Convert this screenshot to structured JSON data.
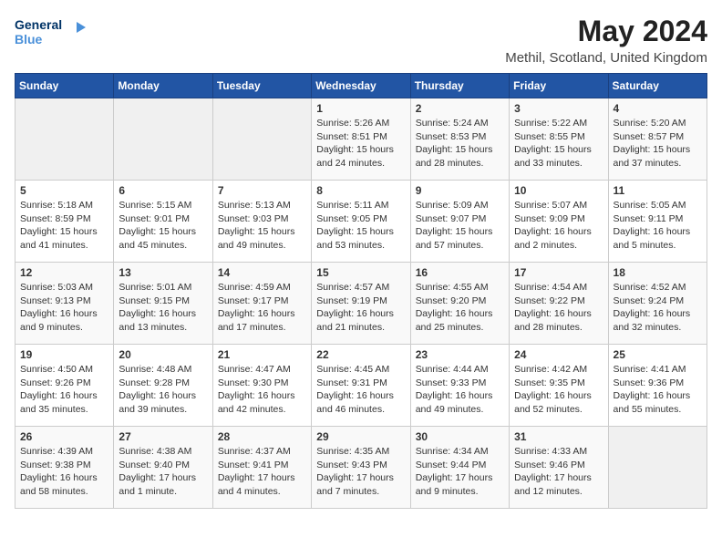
{
  "header": {
    "logo_line1": "General",
    "logo_line2": "Blue",
    "month_year": "May 2024",
    "location": "Methil, Scotland, United Kingdom"
  },
  "days_of_week": [
    "Sunday",
    "Monday",
    "Tuesday",
    "Wednesday",
    "Thursday",
    "Friday",
    "Saturday"
  ],
  "weeks": [
    [
      {
        "day": "",
        "info": ""
      },
      {
        "day": "",
        "info": ""
      },
      {
        "day": "",
        "info": ""
      },
      {
        "day": "1",
        "info": "Sunrise: 5:26 AM\nSunset: 8:51 PM\nDaylight: 15 hours\nand 24 minutes."
      },
      {
        "day": "2",
        "info": "Sunrise: 5:24 AM\nSunset: 8:53 PM\nDaylight: 15 hours\nand 28 minutes."
      },
      {
        "day": "3",
        "info": "Sunrise: 5:22 AM\nSunset: 8:55 PM\nDaylight: 15 hours\nand 33 minutes."
      },
      {
        "day": "4",
        "info": "Sunrise: 5:20 AM\nSunset: 8:57 PM\nDaylight: 15 hours\nand 37 minutes."
      }
    ],
    [
      {
        "day": "5",
        "info": "Sunrise: 5:18 AM\nSunset: 8:59 PM\nDaylight: 15 hours\nand 41 minutes."
      },
      {
        "day": "6",
        "info": "Sunrise: 5:15 AM\nSunset: 9:01 PM\nDaylight: 15 hours\nand 45 minutes."
      },
      {
        "day": "7",
        "info": "Sunrise: 5:13 AM\nSunset: 9:03 PM\nDaylight: 15 hours\nand 49 minutes."
      },
      {
        "day": "8",
        "info": "Sunrise: 5:11 AM\nSunset: 9:05 PM\nDaylight: 15 hours\nand 53 minutes."
      },
      {
        "day": "9",
        "info": "Sunrise: 5:09 AM\nSunset: 9:07 PM\nDaylight: 15 hours\nand 57 minutes."
      },
      {
        "day": "10",
        "info": "Sunrise: 5:07 AM\nSunset: 9:09 PM\nDaylight: 16 hours\nand 2 minutes."
      },
      {
        "day": "11",
        "info": "Sunrise: 5:05 AM\nSunset: 9:11 PM\nDaylight: 16 hours\nand 5 minutes."
      }
    ],
    [
      {
        "day": "12",
        "info": "Sunrise: 5:03 AM\nSunset: 9:13 PM\nDaylight: 16 hours\nand 9 minutes."
      },
      {
        "day": "13",
        "info": "Sunrise: 5:01 AM\nSunset: 9:15 PM\nDaylight: 16 hours\nand 13 minutes."
      },
      {
        "day": "14",
        "info": "Sunrise: 4:59 AM\nSunset: 9:17 PM\nDaylight: 16 hours\nand 17 minutes."
      },
      {
        "day": "15",
        "info": "Sunrise: 4:57 AM\nSunset: 9:19 PM\nDaylight: 16 hours\nand 21 minutes."
      },
      {
        "day": "16",
        "info": "Sunrise: 4:55 AM\nSunset: 9:20 PM\nDaylight: 16 hours\nand 25 minutes."
      },
      {
        "day": "17",
        "info": "Sunrise: 4:54 AM\nSunset: 9:22 PM\nDaylight: 16 hours\nand 28 minutes."
      },
      {
        "day": "18",
        "info": "Sunrise: 4:52 AM\nSunset: 9:24 PM\nDaylight: 16 hours\nand 32 minutes."
      }
    ],
    [
      {
        "day": "19",
        "info": "Sunrise: 4:50 AM\nSunset: 9:26 PM\nDaylight: 16 hours\nand 35 minutes."
      },
      {
        "day": "20",
        "info": "Sunrise: 4:48 AM\nSunset: 9:28 PM\nDaylight: 16 hours\nand 39 minutes."
      },
      {
        "day": "21",
        "info": "Sunrise: 4:47 AM\nSunset: 9:30 PM\nDaylight: 16 hours\nand 42 minutes."
      },
      {
        "day": "22",
        "info": "Sunrise: 4:45 AM\nSunset: 9:31 PM\nDaylight: 16 hours\nand 46 minutes."
      },
      {
        "day": "23",
        "info": "Sunrise: 4:44 AM\nSunset: 9:33 PM\nDaylight: 16 hours\nand 49 minutes."
      },
      {
        "day": "24",
        "info": "Sunrise: 4:42 AM\nSunset: 9:35 PM\nDaylight: 16 hours\nand 52 minutes."
      },
      {
        "day": "25",
        "info": "Sunrise: 4:41 AM\nSunset: 9:36 PM\nDaylight: 16 hours\nand 55 minutes."
      }
    ],
    [
      {
        "day": "26",
        "info": "Sunrise: 4:39 AM\nSunset: 9:38 PM\nDaylight: 16 hours\nand 58 minutes."
      },
      {
        "day": "27",
        "info": "Sunrise: 4:38 AM\nSunset: 9:40 PM\nDaylight: 17 hours\nand 1 minute."
      },
      {
        "day": "28",
        "info": "Sunrise: 4:37 AM\nSunset: 9:41 PM\nDaylight: 17 hours\nand 4 minutes."
      },
      {
        "day": "29",
        "info": "Sunrise: 4:35 AM\nSunset: 9:43 PM\nDaylight: 17 hours\nand 7 minutes."
      },
      {
        "day": "30",
        "info": "Sunrise: 4:34 AM\nSunset: 9:44 PM\nDaylight: 17 hours\nand 9 minutes."
      },
      {
        "day": "31",
        "info": "Sunrise: 4:33 AM\nSunset: 9:46 PM\nDaylight: 17 hours\nand 12 minutes."
      },
      {
        "day": "",
        "info": ""
      }
    ]
  ]
}
